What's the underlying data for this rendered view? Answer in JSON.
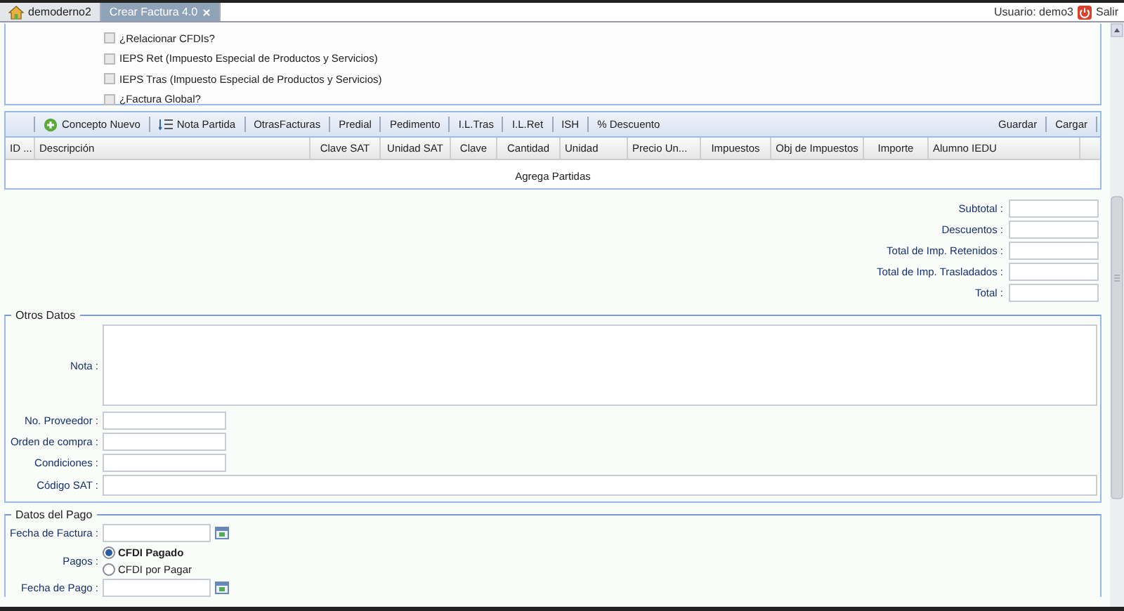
{
  "tabs": [
    {
      "label": "demoderno2",
      "selected": false,
      "kind": "home",
      "closable": false
    },
    {
      "label": "Crear Factura 4.0",
      "selected": true,
      "kind": "page",
      "closable": true
    }
  ],
  "user": {
    "label": "Usuario: demo3",
    "logout": "Salir"
  },
  "options": [
    {
      "label": "¿Relacionar CFDIs?",
      "checked": false
    },
    {
      "label": "IEPS Ret (Impuesto Especial de Productos y Servicios)",
      "checked": false
    },
    {
      "label": "IEPS Tras (Impuesto Especial de Productos y Servicios)",
      "checked": false
    },
    {
      "label": "¿Factura Global?",
      "checked": false
    }
  ],
  "toolbar": {
    "left": [
      {
        "label": "Concepto Nuevo",
        "kind": "add"
      },
      {
        "label": "Nota Partida",
        "kind": "list"
      },
      {
        "label": "OtrasFacturas",
        "kind": "plain"
      },
      {
        "label": "Predial",
        "kind": "plain"
      },
      {
        "label": "Pedimento",
        "kind": "plain"
      },
      {
        "label": "I.L.Tras",
        "kind": "plain"
      },
      {
        "label": "I.L.Ret",
        "kind": "plain"
      },
      {
        "label": "ISH",
        "kind": "plain"
      },
      {
        "label": "% Descuento",
        "kind": "plain"
      }
    ],
    "right": [
      "Guardar",
      "Cargar"
    ]
  },
  "grid": {
    "columns": [
      "ID ...",
      "Descripción",
      "Clave SAT",
      "Unidad SAT",
      "Clave",
      "Cantidad",
      "Unidad",
      "Precio Un...",
      "Impuestos",
      "Obj de Impuestos",
      "Importe",
      "Alumno IEDU"
    ],
    "empty_text": "Agrega Partidas"
  },
  "totals": [
    "Subtotal :",
    "Descuentos :",
    "Total de Imp. Retenidos :",
    "Total de Imp. Trasladados :",
    "Total :"
  ],
  "otros_datos": {
    "legend": "Otros Datos",
    "nota_label": "Nota :",
    "fields": [
      "No. Proveedor :",
      "Orden de compra :",
      "Condiciones :"
    ],
    "codigo_sat_label": "Código SAT :"
  },
  "datos_pago": {
    "legend": "Datos del Pago",
    "fecha_factura_label": "Fecha de Factura :",
    "pagos_label": "Pagos :",
    "pagos": [
      {
        "label": "CFDI Pagado",
        "selected": true
      },
      {
        "label": "CFDI por Pagar",
        "selected": false
      }
    ],
    "fecha_pago_label": "Fecha de Pago :"
  }
}
